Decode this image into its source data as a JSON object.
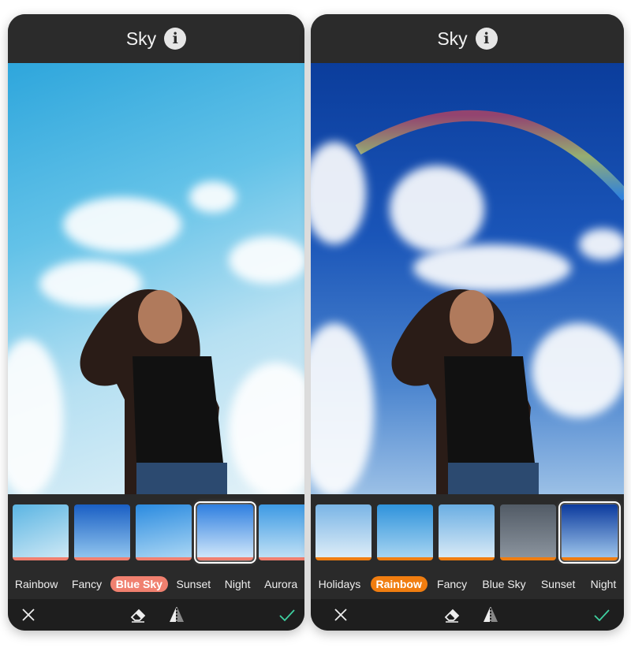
{
  "colors": {
    "left_accent": "#f0806f",
    "right_accent": "#f07d10",
    "check": "#3fd0a0"
  },
  "left": {
    "header": {
      "title": "Sky",
      "info_icon": "info-icon"
    },
    "thumbnails": [
      {
        "label": "Rainbow",
        "bg": "linear-gradient(160deg,#5bb5e3,#cde8f5)"
      },
      {
        "label": "Fancy",
        "bg": "linear-gradient(180deg,#1a5fc4,#8fc4ee)"
      },
      {
        "label": "Blue Sky",
        "bg": "linear-gradient(170deg,#2b8be0,#a9d6f4)"
      },
      {
        "label": "Sunset",
        "bg": "linear-gradient(180deg,#2f7fe0,#cfe6fa)",
        "selected": true
      },
      {
        "label": "Night",
        "bg": "linear-gradient(180deg,#3d9ae4,#bfe0f5)"
      },
      {
        "label": "Aurora",
        "bg": "linear-gradient(180deg,#3d9ae4,#bfe0f5)"
      }
    ],
    "labels": [
      "Rainbow",
      "Fancy",
      "Blue Sky",
      "Sunset",
      "Night",
      "Aurora"
    ],
    "active_label": "Blue Sky"
  },
  "right": {
    "header": {
      "title": "Sky",
      "info_icon": "info-icon"
    },
    "thumbnails": [
      {
        "label": "Holidays",
        "bg": "linear-gradient(180deg,#7ab5e6,#dcecf7)"
      },
      {
        "label": "Rainbow",
        "bg": "linear-gradient(180deg,#2f93dc,#a6d4f1)"
      },
      {
        "label": "Fancy",
        "bg": "linear-gradient(180deg,#6aaee3,#d7e9f6)"
      },
      {
        "label": "Blue Sky",
        "bg": "linear-gradient(180deg,#525b66,#8a939d)"
      },
      {
        "label": "Sunset",
        "bg": "linear-gradient(180deg,#0c3b9e,#9cc3ea)",
        "selected": true
      }
    ],
    "labels": [
      "Holidays",
      "Rainbow",
      "Fancy",
      "Blue Sky",
      "Sunset",
      "Night"
    ],
    "active_label": "Rainbow"
  },
  "toolbar": {
    "cancel_icon": "close-icon",
    "eraser_icon": "eraser-icon",
    "flip_icon": "flip-icon",
    "confirm_icon": "check-icon"
  }
}
